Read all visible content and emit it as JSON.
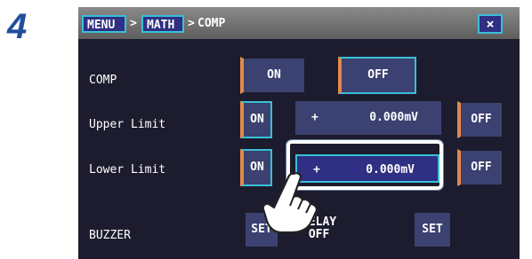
{
  "step_number": "4",
  "breadcrumb": {
    "menu": "MENU",
    "math": "MATH",
    "comp": "COMP",
    "sep1": ">",
    "sep2": ">"
  },
  "close_label": "×",
  "rows": {
    "comp": {
      "label": "COMP",
      "on": "ON",
      "off": "OFF"
    },
    "upper": {
      "label": "Upper Limit",
      "on": "ON",
      "sign": "+",
      "value": "0.000mV",
      "off": "OFF"
    },
    "lower": {
      "label": "Lower Limit",
      "on": "ON",
      "sign": "+",
      "value": "0.000mV",
      "off": "OFF"
    },
    "buzzer": {
      "label": "BUZZER",
      "set1": "SET",
      "delay_line1": "DELAY",
      "delay_line2": "OFF",
      "set2": "SET"
    }
  },
  "icons": {
    "pointer": "pointing-hand-icon",
    "close": "close-icon"
  },
  "colors": {
    "panel_bg": "#1c1c2e",
    "button_bg": "#3b4170",
    "accent_cyan": "#39c0d6",
    "step_blue": "#1f4f9a",
    "active_marker": "#e08a4a"
  }
}
